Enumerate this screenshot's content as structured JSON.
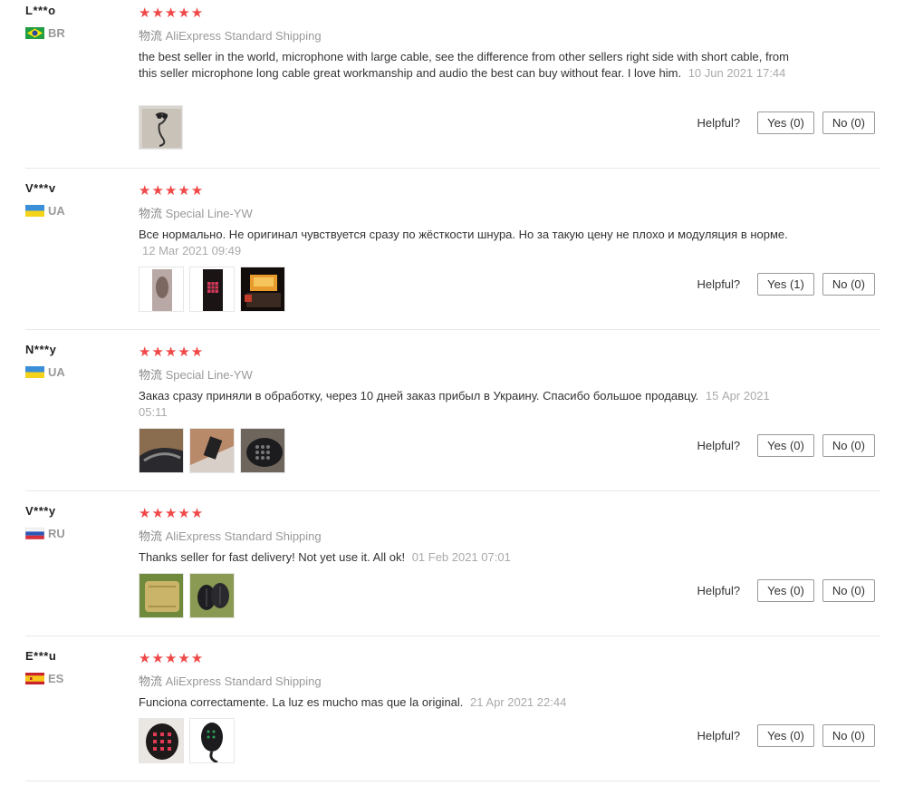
{
  "helpful_label": "Helpful?",
  "star_color": "#f04848",
  "reviews": [
    {
      "user": "L***o",
      "country": "BR",
      "flag_icon": "brazil-flag-icon",
      "stars": "★★★★★",
      "shipping_cn": "物流",
      "shipping": "AliExpress Standard Shipping",
      "text": "the best seller in the world, microphone with large cable, see the difference from other sellers right side with short cable, from this seller microphone long cable great workmanship and audio the best can buy without fear. I love him.",
      "date": "10 Jun 2021 17:44",
      "yes": "Yes (0)",
      "no": "No (0)",
      "photo_count": 1
    },
    {
      "user": "V***v",
      "country": "UA",
      "flag_icon": "ukraine-flag-icon",
      "stars": "★★★★★",
      "shipping_cn": "物流",
      "shipping": "Special Line-YW",
      "text": "Все нормально. Не оригинал чувствуется сразу по жёсткости шнура. Но за такую цену не плохо и модуляция в норме.",
      "date": "12 Mar 2021 09:49",
      "yes": "Yes (1)",
      "no": "No (0)",
      "photo_count": 3
    },
    {
      "user": "N***y",
      "country": "UA",
      "flag_icon": "ukraine-flag-icon",
      "stars": "★★★★★",
      "shipping_cn": "物流",
      "shipping": "Special Line-YW",
      "text": "Заказ сразу приняли в обработку, через 10 дней заказ прибыл в Украину. Спасибо большое продавцу.",
      "date": "15 Apr 2021 05:11",
      "yes": "Yes (0)",
      "no": "No (0)",
      "photo_count": 3
    },
    {
      "user": "V***y",
      "country": "RU",
      "flag_icon": "russia-flag-icon",
      "stars": "★★★★★",
      "shipping_cn": "物流",
      "shipping": "AliExpress Standard Shipping",
      "text": "Thanks seller for fast delivery! Not yet use it. All ok!",
      "date": "01 Feb 2021 07:01",
      "yes": "Yes (0)",
      "no": "No (0)",
      "photo_count": 2
    },
    {
      "user": "E***u",
      "country": "ES",
      "flag_icon": "spain-flag-icon",
      "stars": "★★★★★",
      "shipping_cn": "物流",
      "shipping": "AliExpress Standard Shipping",
      "text": "Funciona correctamente. La luz es mucho mas que la original.",
      "date": "21 Apr 2021 22:44",
      "yes": "Yes (0)",
      "no": "No (0)",
      "photo_count": 2
    }
  ]
}
